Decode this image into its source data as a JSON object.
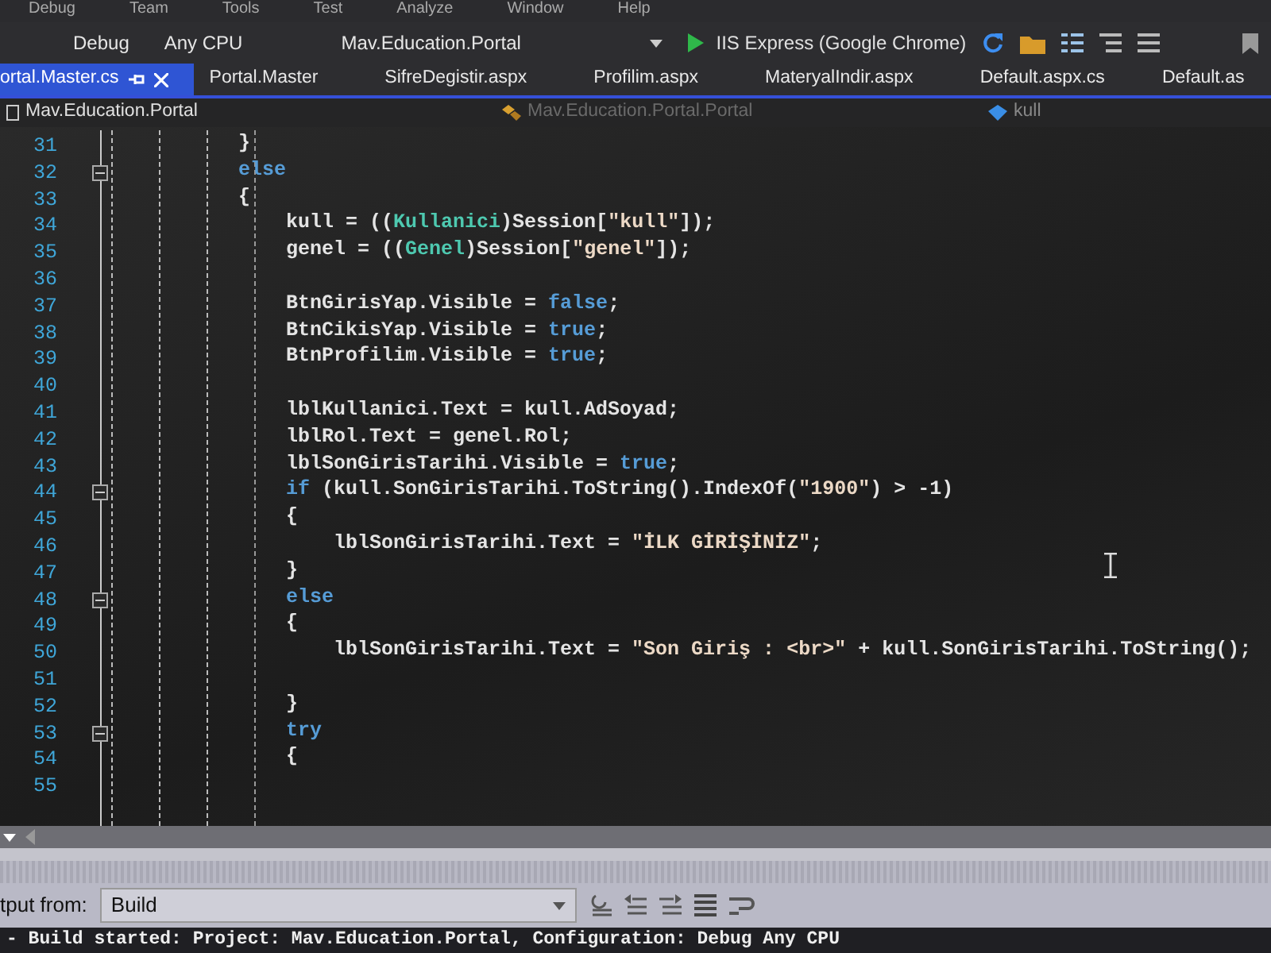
{
  "menu": [
    "Debug",
    "Team",
    "Tools",
    "Test",
    "Analyze",
    "Window",
    "Help"
  ],
  "toolbar": {
    "configuration": "Debug",
    "platform": "Any CPU",
    "startup_project": "Mav.Education.Portal",
    "run_target": "IIS Express (Google Chrome)"
  },
  "tabs": [
    {
      "label": "ortal.Master.cs",
      "selected": true
    },
    {
      "label": "Portal.Master",
      "selected": false
    },
    {
      "label": "SifreDegistir.aspx",
      "selected": false
    },
    {
      "label": "Profilim.aspx",
      "selected": false
    },
    {
      "label": "MateryalIndir.aspx",
      "selected": false
    },
    {
      "label": "Default.aspx.cs",
      "selected": false
    },
    {
      "label": "Default.as",
      "selected": false
    }
  ],
  "navigation_bar": {
    "project": "Mav.Education.Portal",
    "class": "Mav.Education.Portal.Portal",
    "member": "kull"
  },
  "code_lines": [
    {
      "number": "31",
      "collapsible": false,
      "tokens": [
        {
          "kind": "plain",
          "text": "}"
        }
      ]
    },
    {
      "number": "32",
      "collapsible": true,
      "tokens": [
        {
          "kind": "keyword",
          "text": "else"
        }
      ]
    },
    {
      "number": "33",
      "collapsible": false,
      "tokens": [
        {
          "kind": "plain",
          "text": "{"
        }
      ]
    },
    {
      "number": "34",
      "collapsible": false,
      "tokens": [
        {
          "kind": "plain",
          "text": "    kull = (("
        },
        {
          "kind": "type",
          "text": "Kullanici"
        },
        {
          "kind": "plain",
          "text": ")Session["
        },
        {
          "kind": "string",
          "text": "\"kull\""
        },
        {
          "kind": "plain",
          "text": "]);"
        }
      ]
    },
    {
      "number": "35",
      "collapsible": false,
      "tokens": [
        {
          "kind": "plain",
          "text": "    genel = (("
        },
        {
          "kind": "type",
          "text": "Genel"
        },
        {
          "kind": "plain",
          "text": ")Session["
        },
        {
          "kind": "string",
          "text": "\"genel\""
        },
        {
          "kind": "plain",
          "text": "]);"
        }
      ]
    },
    {
      "number": "36",
      "collapsible": false
    },
    {
      "number": "37",
      "collapsible": false,
      "tokens": [
        {
          "kind": "plain",
          "text": "    BtnGirisYap.Visible = "
        },
        {
          "kind": "keyword",
          "text": "false"
        },
        {
          "kind": "plain",
          "text": ";"
        }
      ]
    },
    {
      "number": "38",
      "collapsible": false,
      "tokens": [
        {
          "kind": "plain",
          "text": "    BtnCikisYap.Visible = "
        },
        {
          "kind": "keyword",
          "text": "true"
        },
        {
          "kind": "plain",
          "text": ";"
        }
      ]
    },
    {
      "number": "39",
      "collapsible": false,
      "tokens": [
        {
          "kind": "plain",
          "text": "    BtnProfilim.Visible = "
        },
        {
          "kind": "keyword",
          "text": "true"
        },
        {
          "kind": "plain",
          "text": ";"
        }
      ]
    },
    {
      "number": "40",
      "collapsible": false
    },
    {
      "number": "41",
      "collapsible": false,
      "tokens": [
        {
          "kind": "plain",
          "text": "    lblKullanici.Text = kull.AdSoyad;"
        }
      ]
    },
    {
      "number": "42",
      "collapsible": false,
      "tokens": [
        {
          "kind": "plain",
          "text": "    lblRol.Text = genel.Rol;"
        }
      ]
    },
    {
      "number": "43",
      "collapsible": false,
      "tokens": [
        {
          "kind": "plain",
          "text": "    lblSonGirisTarihi.Visible = "
        },
        {
          "kind": "keyword",
          "text": "true"
        },
        {
          "kind": "plain",
          "text": ";"
        }
      ]
    },
    {
      "number": "44",
      "collapsible": true,
      "tokens": [
        {
          "kind": "keyword",
          "text": "    if"
        },
        {
          "kind": "plain",
          "text": " (kull.SonGirisTarihi.ToString().IndexOf("
        },
        {
          "kind": "string",
          "text": "\"1900\""
        },
        {
          "kind": "plain",
          "text": ") > -1)"
        }
      ]
    },
    {
      "number": "45",
      "collapsible": false,
      "tokens": [
        {
          "kind": "plain",
          "text": "    {"
        }
      ]
    },
    {
      "number": "46",
      "collapsible": false,
      "tokens": [
        {
          "kind": "plain",
          "text": "        lblSonGirisTarihi.Text = "
        },
        {
          "kind": "string",
          "text": "\"İLK GİRİŞİNİZ\""
        },
        {
          "kind": "plain",
          "text": ";"
        }
      ]
    },
    {
      "number": "47",
      "collapsible": false,
      "tokens": [
        {
          "kind": "plain",
          "text": "    }"
        }
      ]
    },
    {
      "number": "48",
      "collapsible": true,
      "tokens": [
        {
          "kind": "keyword",
          "text": "    else"
        }
      ]
    },
    {
      "number": "49",
      "collapsible": false,
      "tokens": [
        {
          "kind": "plain",
          "text": "    {"
        }
      ]
    },
    {
      "number": "50",
      "collapsible": false,
      "tokens": [
        {
          "kind": "plain",
          "text": "        lblSonGirisTarihi.Text = "
        },
        {
          "kind": "string",
          "text": "\"Son Giriş : <br>\""
        },
        {
          "kind": "plain",
          "text": " + kull.SonGirisTarihi.ToString();"
        }
      ]
    },
    {
      "number": "51",
      "collapsible": false
    },
    {
      "number": "52",
      "collapsible": false,
      "tokens": [
        {
          "kind": "plain",
          "text": "    }"
        }
      ]
    },
    {
      "number": "53",
      "collapsible": true,
      "tokens": [
        {
          "kind": "keyword",
          "text": "    try"
        }
      ]
    },
    {
      "number": "54",
      "collapsible": false,
      "tokens": [
        {
          "kind": "plain",
          "text": "    {"
        }
      ]
    },
    {
      "number": "55",
      "collapsible": false
    }
  ],
  "output": {
    "label": "tput from:",
    "source": "Build",
    "text": "- Build started: Project: Mav.Education.Portal, Configuration: Debug Any CPU"
  }
}
